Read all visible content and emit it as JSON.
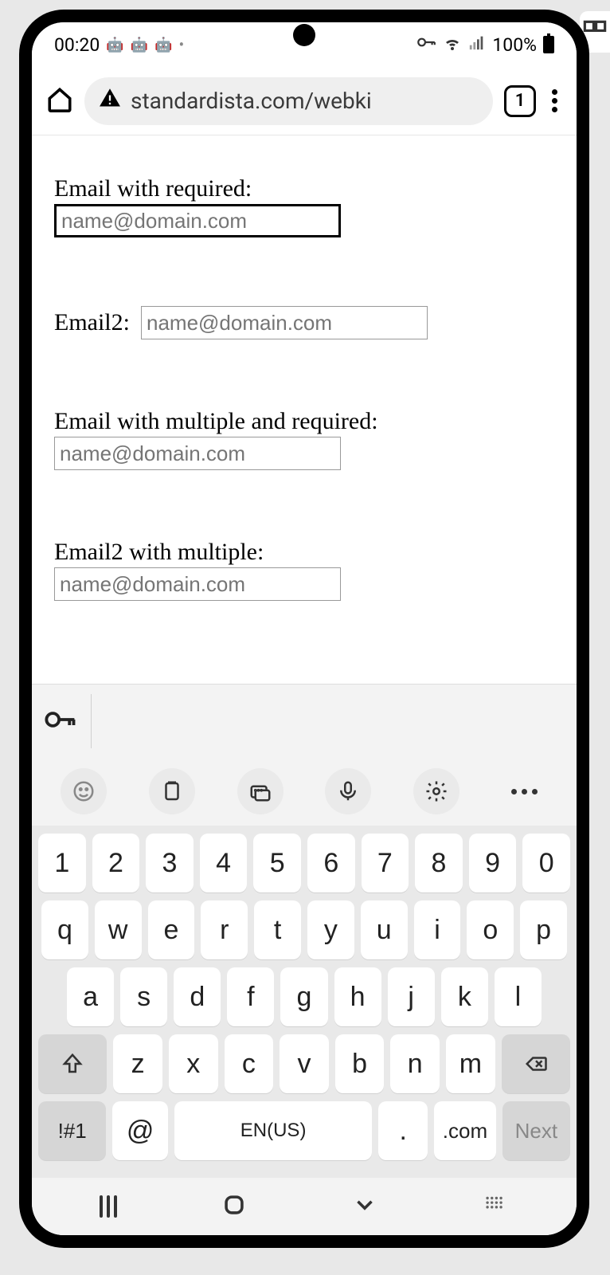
{
  "status": {
    "time": "00:20",
    "battery_pct": "100%"
  },
  "browser": {
    "url": "standardista.com/webki",
    "tab_count": "1"
  },
  "form": {
    "f1": {
      "label": "Email with required:",
      "placeholder": "name@domain.com"
    },
    "f2": {
      "label": "Email2:",
      "placeholder": "name@domain.com"
    },
    "f3": {
      "label": "Email with multiple and required:",
      "placeholder": "name@domain.com"
    },
    "f4": {
      "label": "Email2 with multiple:",
      "placeholder": "name@domain.com"
    }
  },
  "keyboard": {
    "row1": [
      "1",
      "2",
      "3",
      "4",
      "5",
      "6",
      "7",
      "8",
      "9",
      "0"
    ],
    "row2": [
      "q",
      "w",
      "e",
      "r",
      "t",
      "y",
      "u",
      "i",
      "o",
      "p"
    ],
    "row3": [
      "a",
      "s",
      "d",
      "f",
      "g",
      "h",
      "j",
      "k",
      "l"
    ],
    "row4": [
      "z",
      "x",
      "c",
      "v",
      "b",
      "n",
      "m"
    ],
    "sym": "!#1",
    "at": "@",
    "space": "EN(US)",
    "period": ".",
    "dotcom": ".com",
    "next": "Next"
  }
}
